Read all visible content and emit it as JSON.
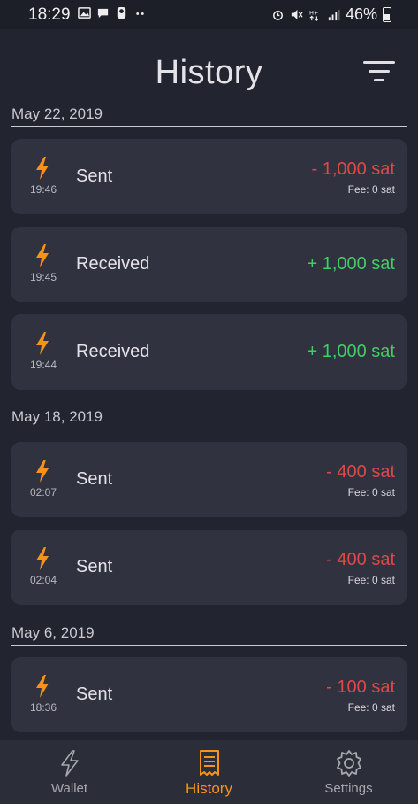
{
  "status_bar": {
    "time": "18:29",
    "battery": "46%"
  },
  "header": {
    "title": "History"
  },
  "colors": {
    "accent": "#f7931a",
    "negative": "#e04848",
    "positive": "#3fcf63",
    "background": "#22242f",
    "card": "#30323f"
  },
  "sections": [
    {
      "date": "May 22, 2019",
      "transactions": [
        {
          "time": "19:46",
          "type": "Sent",
          "amount": "- 1,000 sat",
          "fee": "Fee: 0 sat"
        },
        {
          "time": "19:45",
          "type": "Received",
          "amount": "+ 1,000 sat"
        },
        {
          "time": "19:44",
          "type": "Received",
          "amount": "+ 1,000 sat"
        }
      ]
    },
    {
      "date": "May 18, 2019",
      "transactions": [
        {
          "time": "02:07",
          "type": "Sent",
          "amount": "- 400 sat",
          "fee": "Fee: 0 sat"
        },
        {
          "time": "02:04",
          "type": "Sent",
          "amount": "- 400 sat",
          "fee": "Fee: 0 sat"
        }
      ]
    },
    {
      "date": "May 6, 2019",
      "transactions": [
        {
          "time": "18:36",
          "type": "Sent",
          "amount": "- 100 sat",
          "fee": "Fee: 0 sat"
        }
      ]
    }
  ],
  "nav": [
    {
      "label": "Wallet",
      "icon": "lightning-outline-icon"
    },
    {
      "label": "History",
      "icon": "receipt-icon",
      "active": true
    },
    {
      "label": "Settings",
      "icon": "gear-icon"
    }
  ]
}
